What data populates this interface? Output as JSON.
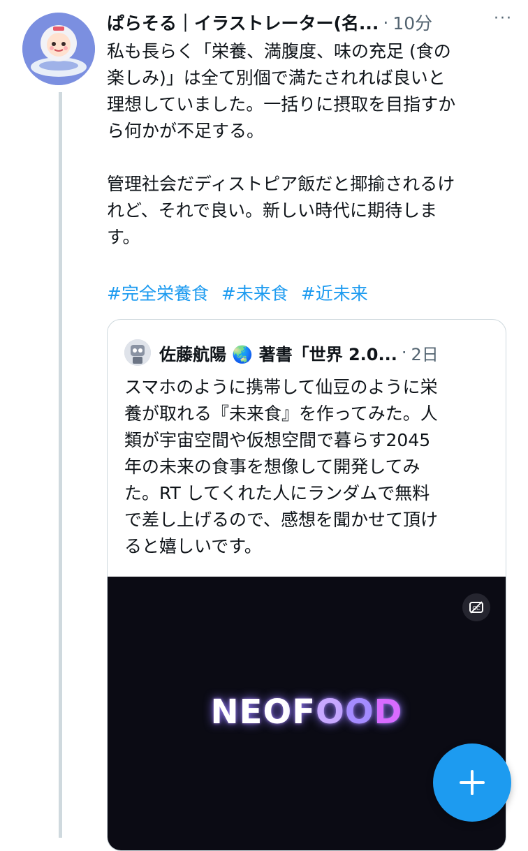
{
  "tweet": {
    "author": "ぱらそる｜イラストレーター(名...",
    "separator": "·",
    "time": "10分",
    "more": "···",
    "text": "私も長らく「栄養、満腹度、味の充足 (食の\n楽しみ)」は全て別個で満たされれば良いと\n理想していました。一括りに摂取を目指すか\nら何かが不足する。\n\n管理社会だディストピア飯だと揶揄されるけ\nれど、それで良い。新しい時代に期待しま\nす。",
    "hashtags": [
      "#完全栄養食",
      "#未来食",
      "#近未来"
    ]
  },
  "quote": {
    "author": "佐藤航陽 🌏 著書「世界 2.0...",
    "separator": "·",
    "time": "2日",
    "text": "スマホのように携帯して仙豆のように栄\n養が取れる『未来食』を作ってみた。人\n類が宇宙空間や仮想空間で暮らす2045\n年の未来の食事を想像して開発してみ\nた。RT してくれた人にランダムで無料\nで差し上げるので、感想を聞かせて頂け\nると嬉しいです。",
    "media_title": {
      "part1": "NEO",
      "part2": "F",
      "part3": "O",
      "part4": "O",
      "part5": "D"
    },
    "media_icon": "captions-icon"
  },
  "compose_button": {
    "icon": "plus-icon"
  },
  "colors": {
    "accent": "#1d9bf0",
    "text": "#0f1419",
    "muted": "#536471",
    "border": "#cfd9de"
  }
}
